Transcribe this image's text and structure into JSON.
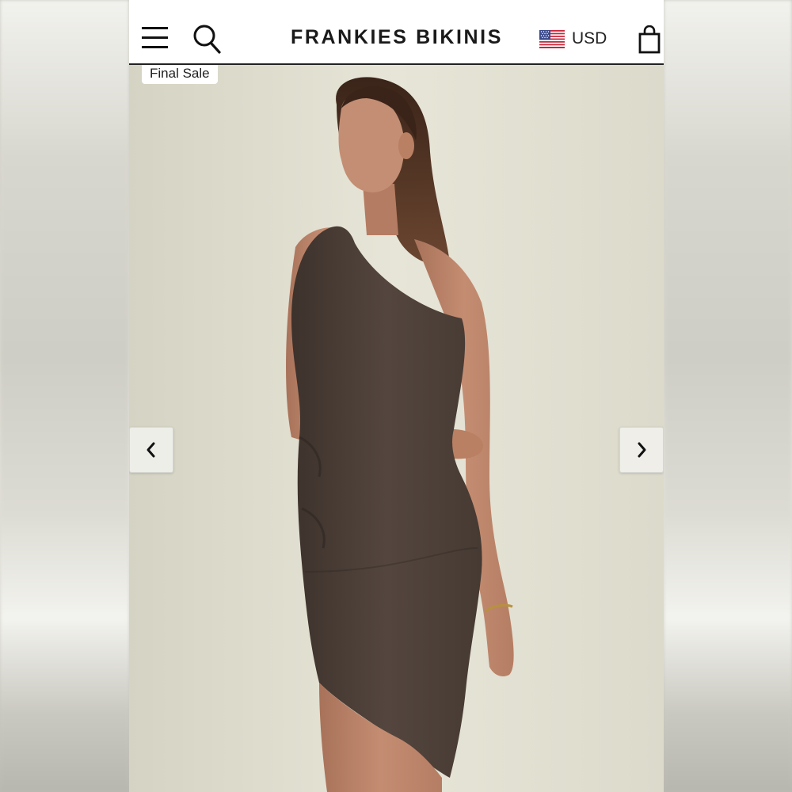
{
  "header": {
    "brand": "FRANKIES BIKINIS",
    "currency": "USD"
  },
  "product": {
    "badge": "Final Sale"
  },
  "icons": {
    "menu": "menu-icon",
    "search": "search-icon",
    "flag": "us-flag-icon",
    "bag": "shopping-bag-icon",
    "prev": "chevron-left-icon",
    "next": "chevron-right-icon"
  },
  "colors": {
    "header_bg": "#ffffff",
    "text": "#1a1a1a",
    "dress": "#4a3d36",
    "wall": "#e4e2d3"
  }
}
